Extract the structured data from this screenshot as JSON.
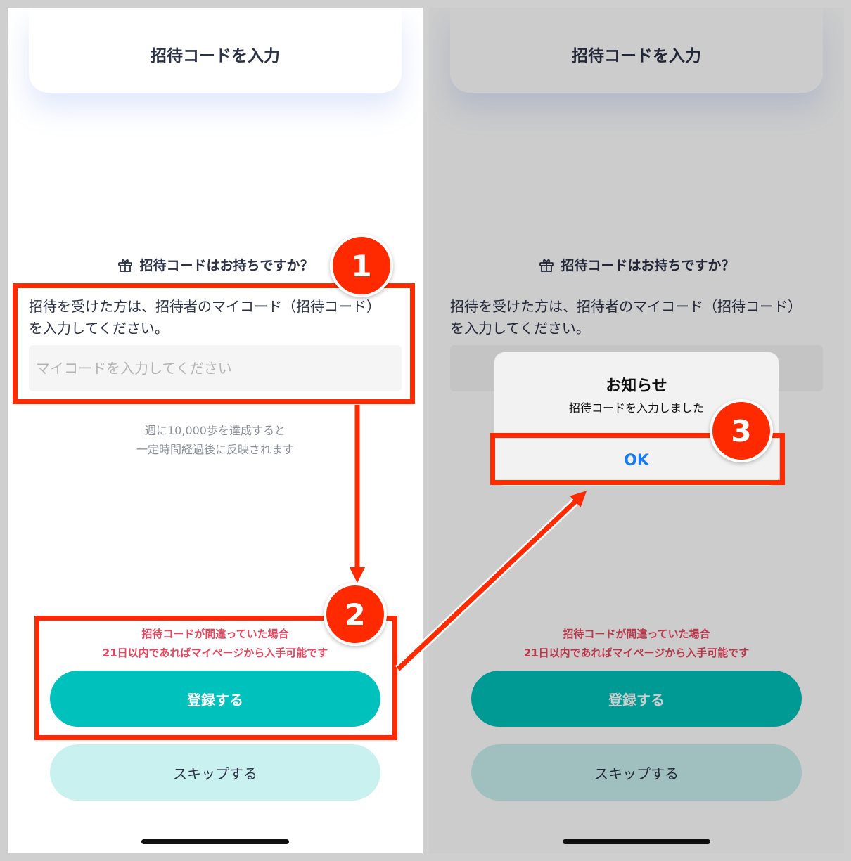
{
  "screen_before": {
    "header_title": "招待コードを入力",
    "question": "招待コードはお持ちですか？",
    "description_line1": "招待を受けた方は、招待者のマイコード（招待コード）",
    "description_line2": "を入力してください。",
    "code_placeholder": "マイコードを入力してください",
    "note_line1": "週に10,000歩を達成すると",
    "note_line2": "一定時間経過後に反映されます",
    "warning_line1": "招待コードが間違っていた場合",
    "warning_line2": "21日以内であればマイページから入手可能です",
    "register_label": "登録する",
    "skip_label": "スキップする"
  },
  "screen_after": {
    "header_title": "招待コードを入力",
    "question": "招待コードはお持ちですか？",
    "description_line1": "招待を受けた方は、招待者のマイコード（招待コード）",
    "description_line2": "を入力してください。",
    "warning_line1": "招待コードが間違っていた場合",
    "warning_line2": "21日以内であればマイページから入手可能です",
    "register_label": "登録する",
    "skip_label": "スキップする",
    "alert": {
      "title": "お知らせ",
      "message": "招待コードを入力しました",
      "ok_label": "OK"
    }
  },
  "annotations": {
    "badge_1": "1",
    "badge_2": "2",
    "badge_3": "3"
  },
  "colors": {
    "accent": "#00c1bb",
    "highlight": "#ff2a00",
    "warning_text": "#e6455e",
    "link_blue": "#1a7af0"
  }
}
